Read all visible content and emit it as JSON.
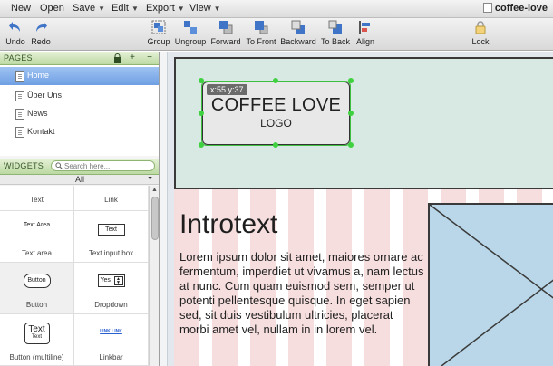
{
  "menubar": {
    "items": [
      {
        "label": "New",
        "has_caret": false
      },
      {
        "label": "Open",
        "has_caret": false
      },
      {
        "label": "Save",
        "has_caret": true
      },
      {
        "label": "Edit",
        "has_caret": true
      },
      {
        "label": "Export",
        "has_caret": true
      },
      {
        "label": "View",
        "has_caret": true
      }
    ],
    "document_title": "coffee-love"
  },
  "toolbar": {
    "undo": "Undo",
    "redo": "Redo",
    "group": "Group",
    "ungroup": "Ungroup",
    "forward": "Forward",
    "to_front": "To Front",
    "backward": "Backward",
    "to_back": "To Back",
    "align": "Align",
    "lock": "Lock"
  },
  "pages": {
    "header": "PAGES",
    "items": [
      {
        "label": "Home",
        "active": true
      },
      {
        "label": "Über Uns",
        "active": false
      },
      {
        "label": "News",
        "active": false
      },
      {
        "label": "Kontakt",
        "active": false
      }
    ]
  },
  "widgets": {
    "header": "WIDGETS",
    "search_placeholder": "Search here...",
    "filter": "All",
    "items": [
      {
        "label": "Text",
        "preview": ""
      },
      {
        "label": "Link",
        "preview": ""
      },
      {
        "label": "Text area",
        "preview": "Text Area"
      },
      {
        "label": "Text input box",
        "preview": "Text"
      },
      {
        "label": "Button",
        "preview": "Button"
      },
      {
        "label": "Dropdown",
        "preview": "Yes"
      },
      {
        "label": "Button (multiline)",
        "preview": "Text"
      },
      {
        "label": "Linkbar",
        "preview": "LINK LINK"
      }
    ],
    "multiline_preview_sub": "Text"
  },
  "canvas": {
    "logo_title": "COFFEE LOVE",
    "logo_subtitle": "LOGO",
    "coord_tooltip": "x:55 y:37",
    "intro_title": "Introtext",
    "intro_body": "Lorem ipsum dolor sit amet, maiores ornare ac fermentum, imperdiet ut vivamus a, nam lectus at nunc. Cum quam euismod sem, semper ut potenti pellentesque quisque. In eget sapien sed, sit duis vestibulum ultricies, placerat morbi amet vel, nullam in in lorem vel."
  },
  "colors": {
    "selection": "#3fbf3f",
    "active_page": "#6f9fe3",
    "header_fill": "#d8e9e4",
    "stripe": "#f7dede",
    "image_fill": "#b9d7e8"
  }
}
